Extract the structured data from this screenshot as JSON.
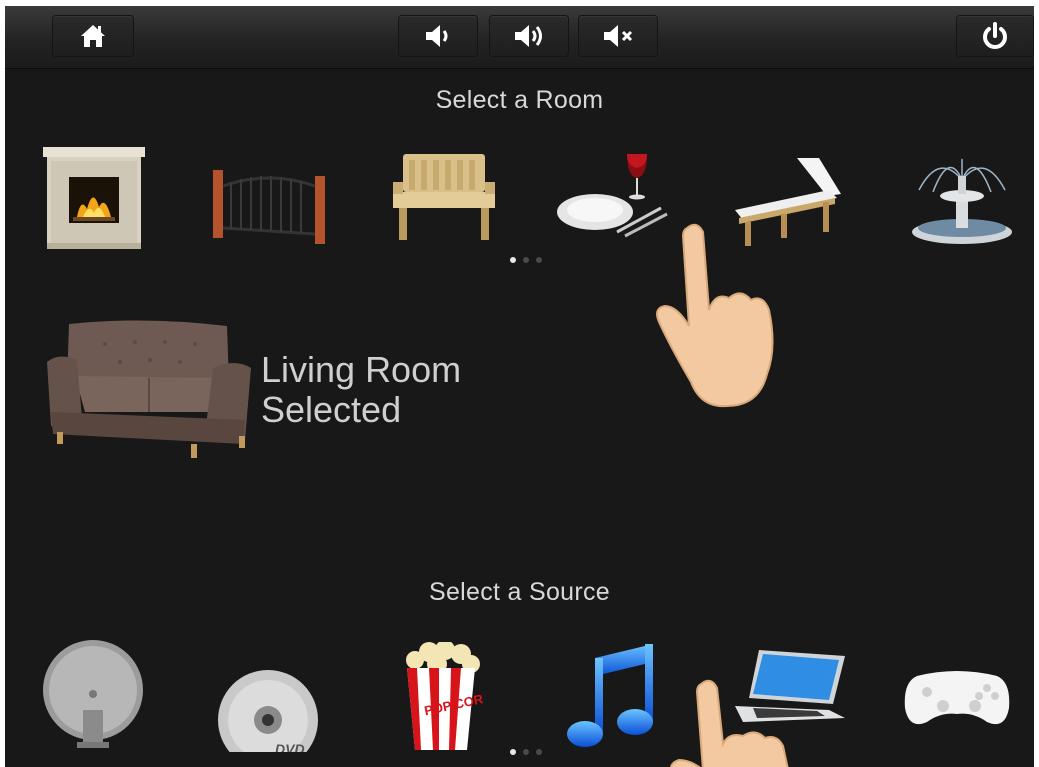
{
  "toolbar": {
    "home_icon": "home-icon",
    "volume_down_icon": "volume-down-icon",
    "volume_up_icon": "volume-up-icon",
    "mute_icon": "mute-icon",
    "power_icon": "power-icon"
  },
  "rooms": {
    "title": "Select a Room",
    "items": [
      {
        "icon": "fireplace-icon"
      },
      {
        "icon": "gate-icon"
      },
      {
        "icon": "bench-icon"
      },
      {
        "icon": "dining-icon"
      },
      {
        "icon": "lounge-chair-icon"
      },
      {
        "icon": "fountain-icon"
      }
    ],
    "page_dots": {
      "count": 3,
      "active": 0
    }
  },
  "selection": {
    "line1": "Living Room",
    "line2": "Selected",
    "icon": "sofa-icon"
  },
  "sources": {
    "title": "Select a Source",
    "items": [
      {
        "icon": "satellite-dish-icon"
      },
      {
        "icon": "dvd-icon",
        "label": "DVD"
      },
      {
        "icon": "popcorn-icon",
        "label": "POP CORN"
      },
      {
        "icon": "music-note-icon"
      },
      {
        "icon": "laptop-icon"
      },
      {
        "icon": "game-controller-icon"
      }
    ],
    "page_dots": {
      "count": 3,
      "active": 0
    }
  },
  "colors": {
    "background": "#181818",
    "toolbar": "#2a2a2a",
    "text": "#d8d8d8"
  }
}
